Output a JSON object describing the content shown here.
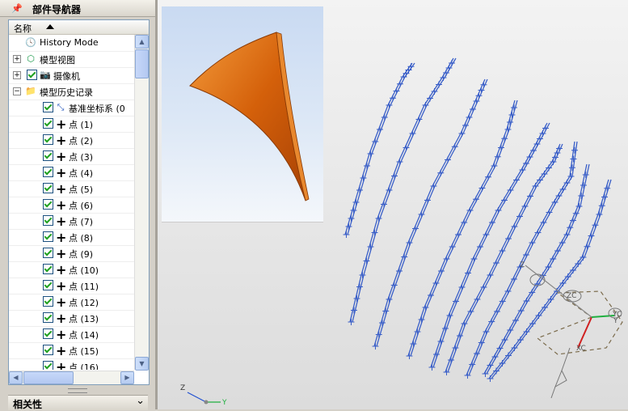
{
  "navigator": {
    "title": "部件导航器",
    "column_header": "名称",
    "items": [
      {
        "label": "History Mode",
        "kind": "history"
      },
      {
        "label": "模型视图",
        "kind": "model-views"
      },
      {
        "label": "摄像机",
        "kind": "cameras"
      },
      {
        "label": "模型历史记录",
        "kind": "model-history"
      },
      {
        "label": "基准坐标系 (0",
        "kind": "datum-csys"
      },
      {
        "label": "点 (1)",
        "kind": "point"
      },
      {
        "label": "点 (2)",
        "kind": "point"
      },
      {
        "label": "点 (3)",
        "kind": "point"
      },
      {
        "label": "点 (4)",
        "kind": "point"
      },
      {
        "label": "点 (5)",
        "kind": "point"
      },
      {
        "label": "点 (6)",
        "kind": "point"
      },
      {
        "label": "点 (7)",
        "kind": "point"
      },
      {
        "label": "点 (8)",
        "kind": "point"
      },
      {
        "label": "点 (9)",
        "kind": "point"
      },
      {
        "label": "点 (10)",
        "kind": "point"
      },
      {
        "label": "点 (11)",
        "kind": "point"
      },
      {
        "label": "点 (12)",
        "kind": "point"
      },
      {
        "label": "点 (13)",
        "kind": "point"
      },
      {
        "label": "点 (14)",
        "kind": "point"
      },
      {
        "label": "点 (15)",
        "kind": "point"
      },
      {
        "label": "点 (16)",
        "kind": "point"
      }
    ]
  },
  "relation_panel": {
    "title": "相关性"
  },
  "viewport": {
    "triad": {
      "z": "Z",
      "y": "Y"
    },
    "wcs": {
      "zc": "ZC",
      "yc": "YC",
      "xc": "XC",
      "y": "Y"
    }
  },
  "colors": {
    "curve": "#3a5fc8",
    "blade": "#d4600a",
    "check": "#21a121",
    "axis_x": "#d02020",
    "axis_y": "#20b040",
    "axis_z": "#2050d0"
  }
}
